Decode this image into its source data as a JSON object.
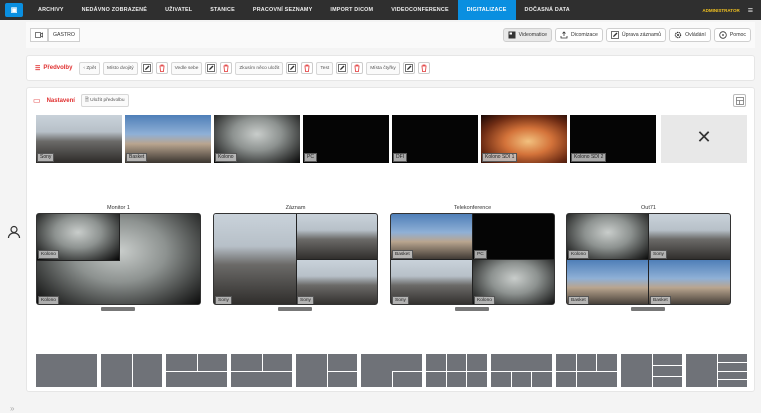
{
  "nav": {
    "items": [
      "ARCHIVY",
      "NEDÁVNO ZOBRAZENÉ",
      "UŽIVATEL",
      "STANICE",
      "PRACOVNÍ SEZNAMY",
      "IMPORT DICOM",
      "VIDEOCONFERENCE",
      "DIGITALIZACE",
      "DOČASNÁ DATA"
    ],
    "active_index": 7,
    "user": "ADMINISTRATOR"
  },
  "toolbar": {
    "camera_label": "GASTRO",
    "buttons": [
      "Videomatice",
      "Dicomizace",
      "Úprava záznamů",
      "Ovládání",
      "Pomoc"
    ]
  },
  "presets": {
    "label": "Předvolby",
    "back": "Zpět",
    "items": [
      "Místo dvojitý",
      "Vedle sebe",
      "Zkusím něco uložit",
      "Test",
      "Místa čtyřky"
    ]
  },
  "panel": {
    "title": "Nastavení",
    "save_label": "Uložit předvolbu"
  },
  "sources": [
    "Sony",
    "Basket",
    "Kolono",
    "PC",
    "DFI",
    "Kolono SDI 1",
    "Kolono SDI 2"
  ],
  "empty_source_symbol": "✕",
  "monitors": [
    {
      "title": "Monitor 1",
      "labels": [
        "Kolono",
        "Kolono"
      ]
    },
    {
      "title": "Záznam",
      "labels": [
        "Sony",
        "Sony"
      ]
    },
    {
      "title": "Telekonference",
      "labels": [
        "Basket",
        "PC",
        "Sony",
        "Kolono"
      ]
    },
    {
      "title": "Out71",
      "labels": [
        "Kolono",
        "Sony",
        "Basket",
        "Basket"
      ]
    }
  ],
  "layout_count": 11,
  "colors": {
    "accent": "#0a8fe0",
    "danger": "#e03030",
    "nav_bg": "#2f2f2f"
  }
}
